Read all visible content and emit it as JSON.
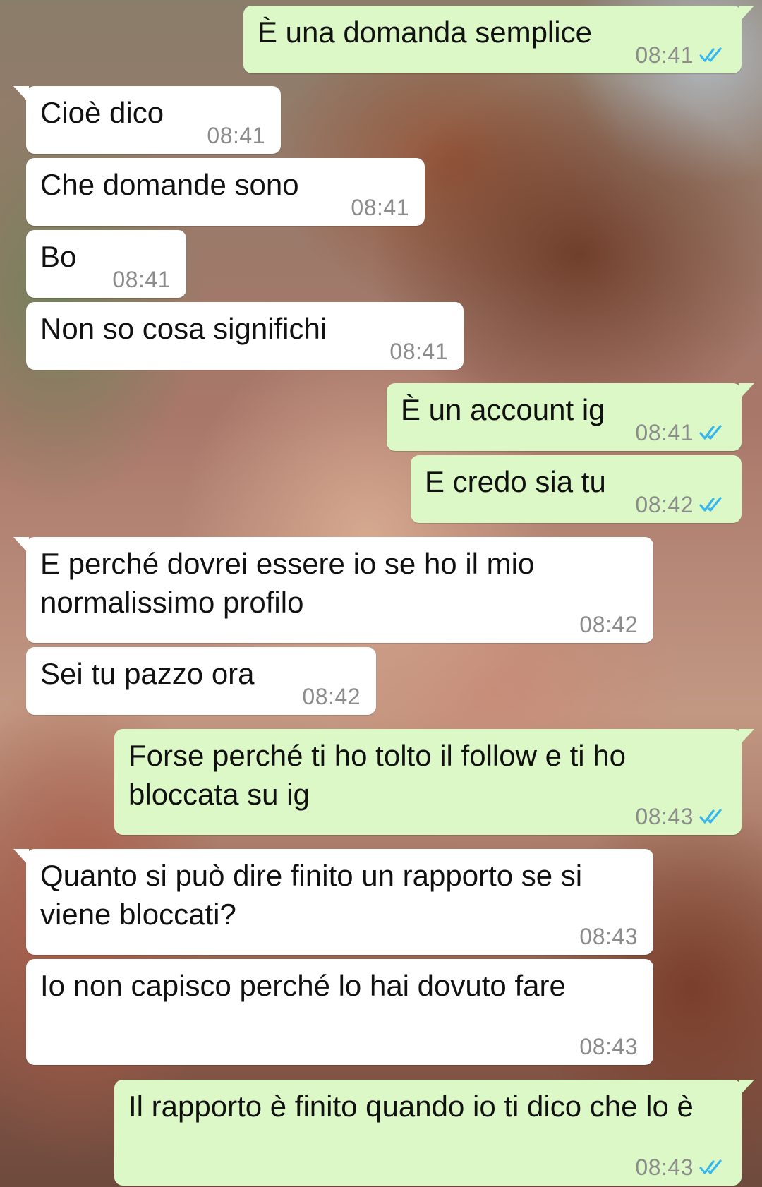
{
  "colors": {
    "incoming_bubble": "#ffffff",
    "outgoing_bubble": "#dcf8c6",
    "timestamp": "#8c8c8c",
    "read_ticks": "#34b7f1"
  },
  "messages": [
    {
      "direction": "out",
      "text": "È una domanda semplice",
      "time": "08:41",
      "status": "read",
      "icon": "double-check-icon"
    },
    {
      "direction": "in",
      "text": "Cioè dico",
      "time": "08:41"
    },
    {
      "direction": "in",
      "text": "Che domande sono",
      "time": "08:41"
    },
    {
      "direction": "in",
      "text": "Bo",
      "time": "08:41"
    },
    {
      "direction": "in",
      "text": "Non so cosa significhi",
      "time": "08:41"
    },
    {
      "direction": "out",
      "text": "È un account ig",
      "time": "08:41",
      "status": "read",
      "icon": "double-check-icon"
    },
    {
      "direction": "out",
      "text": "E credo sia tu",
      "time": "08:42",
      "status": "read",
      "icon": "double-check-icon"
    },
    {
      "direction": "in",
      "text": "E perché dovrei essere io se ho il mio normalissimo profilo",
      "time": "08:42"
    },
    {
      "direction": "in",
      "text": "Sei tu pazzo ora",
      "time": "08:42"
    },
    {
      "direction": "out",
      "text": "Forse perché ti ho tolto il follow e ti ho bloccata su ig",
      "time": "08:43",
      "status": "read",
      "icon": "double-check-icon"
    },
    {
      "direction": "in",
      "text": "Quanto si può dire finito un rapporto se si viene bloccati?",
      "time": "08:43"
    },
    {
      "direction": "in",
      "text": "Io non capisco perché lo hai dovuto fare",
      "time": "08:43"
    },
    {
      "direction": "out",
      "text": "Il rapporto è finito quando io ti dico che lo è",
      "time": "08:43",
      "status": "read",
      "icon": "double-check-icon"
    }
  ]
}
